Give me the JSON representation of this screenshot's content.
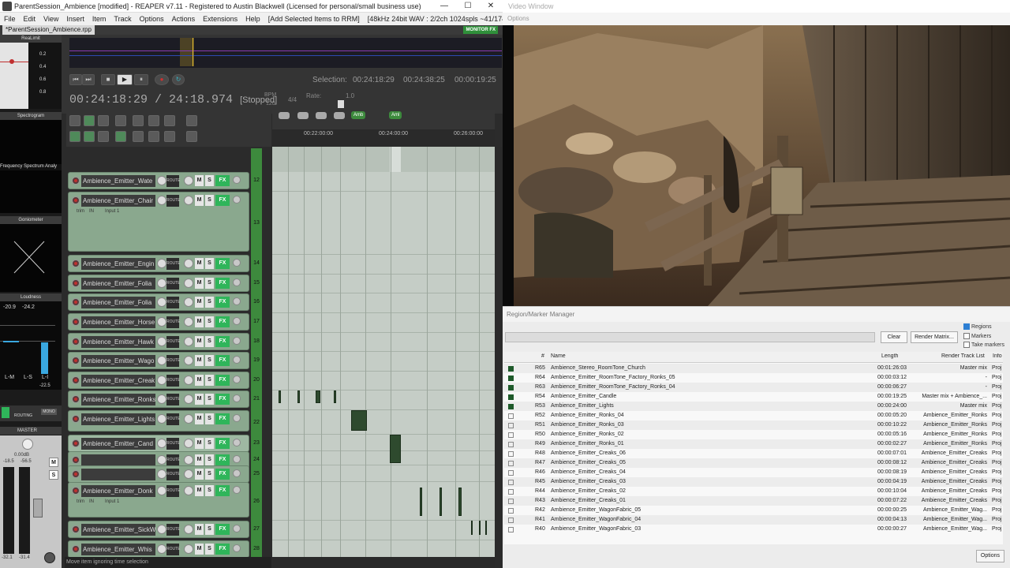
{
  "reaper": {
    "title": "ParentSession_Ambience [modified] - REAPER v7.11 - Registered to Austin Blackwell (Licensed for personal/small business use)",
    "menu": [
      "File",
      "Edit",
      "View",
      "Insert",
      "Item",
      "Track",
      "Options",
      "Actions",
      "Extensions",
      "Help",
      "[Add Selected Items to RRM]"
    ],
    "audio_info": "[48kHz 24bit WAV : 2/2ch 1024spls ~41/174ms WaveOut]",
    "project_tab": "*ParentSession_Ambience.rpp",
    "monitor_label": "MONITOR FX",
    "left_panel": {
      "reallimit": "ReaLimit",
      "limit_values": [
        "0.2",
        "0.4",
        "0.6",
        "0.8"
      ],
      "spectrogram": "Spectrogram",
      "freq_analyzer": "Frequency Spectrum Analy",
      "goniometer": "Goniometer",
      "loudness": "Loudness",
      "loud_values": [
        "-20.9",
        "-24.2"
      ],
      "loud_labels": [
        "L-M",
        "L-S",
        "L-I"
      ],
      "loud_bottom": "-22.5",
      "routing": "ROUTING",
      "mono": "MONO",
      "master": "MASTER",
      "master_db": "0.00dB",
      "master_vals": [
        "-18.5",
        "-56.5"
      ],
      "master_foot": [
        "-32.1",
        "-31.4"
      ]
    },
    "transport": {
      "timecode": "00:24:18:29 / 24:18.974",
      "status": "[Stopped]",
      "selection_label": "Selection:",
      "selection_start": "00:24:18:29",
      "selection_end": "00:24:38:25",
      "selection_len": "00:00:19:25",
      "bpm_label": "BPM",
      "bpm": "120",
      "sig": "4/4",
      "rate_label": "Rate:",
      "rate": "1.0"
    },
    "markers": [
      "Amb",
      "Aml"
    ],
    "ruler_times": [
      "00:22:00:00",
      "00:24:00:00",
      "00:26:00:00"
    ],
    "tracks": [
      {
        "name": "Ambience_Emitter_Wate",
        "num": "12"
      },
      {
        "name": "Ambience_Emitter_Chair",
        "num": "13"
      },
      {
        "name": "Ambience_Emitter_Engin",
        "num": "14"
      },
      {
        "name": "Ambience_Emitter_Folia",
        "num": "15"
      },
      {
        "name": "Ambience_Emitter_Folia",
        "num": "16"
      },
      {
        "name": "Ambience_Emitter_Horse",
        "num": "17"
      },
      {
        "name": "Ambience_Emitter_Hawk",
        "num": "18"
      },
      {
        "name": "Ambience_Emitter_Wago",
        "num": "19"
      },
      {
        "name": "Ambience_Emitter_Creak",
        "num": "20"
      },
      {
        "name": "Ambience_Emitter_Ronks",
        "num": "21"
      },
      {
        "name": "Ambience_Emitter_Lights",
        "num": "22"
      },
      {
        "name": "Ambience_Emitter_Cand",
        "num": "23"
      },
      {
        "name": "",
        "num": "24"
      },
      {
        "name": "",
        "num": "25"
      },
      {
        "name": "Ambience_Emitter_Donk",
        "num": "26"
      },
      {
        "name": "Ambience_Emitter_SickW",
        "num": "27"
      },
      {
        "name": "Ambience_Emitter_Whis",
        "num": "28"
      }
    ],
    "track_route": "ROUTE",
    "track_m": "M",
    "track_s": "S",
    "track_fx": "FX",
    "trim": "trim",
    "in": "IN",
    "input": "Input 1",
    "status_msg": "Move item ignoring time selection"
  },
  "video": {
    "title": "Video Window",
    "options": "Options"
  },
  "rmm": {
    "title": "Region/Marker Manager",
    "clear": "Clear",
    "render_matrix": "Render Matrix...",
    "checks": [
      {
        "label": "Regions",
        "on": true
      },
      {
        "label": "Markers",
        "on": false
      },
      {
        "label": "Take markers",
        "on": false
      }
    ],
    "columns": {
      "num": "#",
      "name": "Name",
      "length": "Length",
      "render": "Render Track List",
      "info": "Info"
    },
    "rows": [
      {
        "id": "R65",
        "name": "Ambience_Stereo_RoomTone_Church",
        "length": "00:01:26:03",
        "render": "Master mix",
        "info": "Proj",
        "on": true
      },
      {
        "id": "R64",
        "name": "Ambience_Emitter_RoomTone_Factory_Ronks_05",
        "length": "00:00:03:12",
        "render": "-",
        "info": "Proj",
        "on": true
      },
      {
        "id": "R63",
        "name": "Ambience_Emitter_RoomTone_Factory_Ronks_04",
        "length": "00:00:06:27",
        "render": "-",
        "info": "Proj",
        "on": true
      },
      {
        "id": "R54",
        "name": "Ambience_Emitter_Candle",
        "length": "00:00:19:25",
        "render": "Master mix + Ambience_...",
        "info": "Proj",
        "on": true
      },
      {
        "id": "R53",
        "name": "Ambience_Emitter_Lights",
        "length": "00:00:24:00",
        "render": "Master mix",
        "info": "Proj",
        "on": true
      },
      {
        "id": "R52",
        "name": "Ambience_Emitter_Ronks_04",
        "length": "00:00:05:20",
        "render": "Ambience_Emitter_Ronks",
        "info": "Proj",
        "on": false
      },
      {
        "id": "R51",
        "name": "Ambience_Emitter_Ronks_03",
        "length": "00:00:10:22",
        "render": "Ambience_Emitter_Ronks",
        "info": "Proj",
        "on": false
      },
      {
        "id": "R50",
        "name": "Ambience_Emitter_Ronks_02",
        "length": "00:00:05:16",
        "render": "Ambience_Emitter_Ronks",
        "info": "Proj",
        "on": false
      },
      {
        "id": "R49",
        "name": "Ambience_Emitter_Ronks_01",
        "length": "00:00:02:27",
        "render": "Ambience_Emitter_Ronks",
        "info": "Proj",
        "on": false
      },
      {
        "id": "R48",
        "name": "Ambience_Emitter_Creaks_06",
        "length": "00:00:07:01",
        "render": "Ambience_Emitter_Creaks",
        "info": "Proj",
        "on": false
      },
      {
        "id": "R47",
        "name": "Ambience_Emitter_Creaks_05",
        "length": "00:00:08:12",
        "render": "Ambience_Emitter_Creaks",
        "info": "Proj",
        "on": false
      },
      {
        "id": "R46",
        "name": "Ambience_Emitter_Creaks_04",
        "length": "00:00:08:19",
        "render": "Ambience_Emitter_Creaks",
        "info": "Proj",
        "on": false
      },
      {
        "id": "R45",
        "name": "Ambience_Emitter_Creaks_03",
        "length": "00:00:04:19",
        "render": "Ambience_Emitter_Creaks",
        "info": "Proj",
        "on": false
      },
      {
        "id": "R44",
        "name": "Ambience_Emitter_Creaks_02",
        "length": "00:00:10:04",
        "render": "Ambience_Emitter_Creaks",
        "info": "Proj",
        "on": false
      },
      {
        "id": "R43",
        "name": "Ambience_Emitter_Creaks_01",
        "length": "00:00:07:22",
        "render": "Ambience_Emitter_Creaks",
        "info": "Proj",
        "on": false
      },
      {
        "id": "R42",
        "name": "Ambience_Emitter_WagonFabric_05",
        "length": "00:00:00:25",
        "render": "Ambience_Emitter_Wag...",
        "info": "Proj",
        "on": false
      },
      {
        "id": "R41",
        "name": "Ambience_Emitter_WagonFabric_04",
        "length": "00:00:04:13",
        "render": "Ambience_Emitter_Wag...",
        "info": "Proj",
        "on": false
      },
      {
        "id": "R40",
        "name": "Ambience_Emitter_WagonFabric_03",
        "length": "00:00:00:27",
        "render": "Ambience_Emitter_Wag...",
        "info": "Proj",
        "on": false
      }
    ],
    "options": "Options"
  },
  "colors": {
    "track_green": "#8aa88e",
    "fx_green": "#2fb55a",
    "region": "#2e4a2e",
    "select_blue": "#2d7fd3"
  }
}
